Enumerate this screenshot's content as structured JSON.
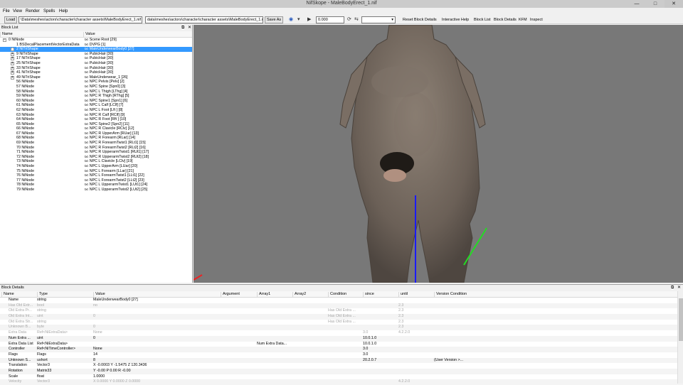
{
  "window": {
    "title": "NifSkope - MaleBodyErect_1.nif",
    "min": "—",
    "max": "□",
    "close": "✕"
  },
  "menu": [
    "File",
    "View",
    "Render",
    "Spells",
    "Help"
  ],
  "toolbar": {
    "load_label": "Load",
    "load_path": "\\Data\\meshes\\actors\\character\\character assets\\MaleBodyErect_1.nif",
    "save_path": "data\\meshes\\actors\\character\\character assets\\MaleBodyErect_1.nif",
    "save_as_label": "Save As",
    "time_value": "0.000",
    "reset_block_details": "Reset Block Details",
    "interactive_help": "Interactive Help",
    "block_list": "Block List",
    "block_details": "Block Details",
    "kfm": "KFM",
    "inspect": "Inspect"
  },
  "blocklist": {
    "title": "Block List",
    "col_name": "Name",
    "col_value": "Value",
    "rows": [
      {
        "name": "0 NiNode",
        "value": "Scene Root [29]",
        "depth": 0,
        "expand": "-"
      },
      {
        "name": "1 BSDecalPlacementVectorExtraData",
        "value": "DVPG [1]",
        "depth": 1
      },
      {
        "name": "2 NiTriShape",
        "value": "MaleUnderwearBody0 [27]",
        "depth": 1,
        "expand": "+",
        "selected": true
      },
      {
        "name": "9 NiTriShape",
        "value": "PubicHair [30]",
        "depth": 1,
        "expand": "+"
      },
      {
        "name": "17 NiTriShape",
        "value": "PubicHair [30]",
        "depth": 1,
        "expand": "+"
      },
      {
        "name": "25 NiTriShape",
        "value": "PubicHair [30]",
        "depth": 1,
        "expand": "+"
      },
      {
        "name": "33 NiTriShape",
        "value": "PubicHair [30]",
        "depth": 1,
        "expand": "+"
      },
      {
        "name": "41 NiTriShape",
        "value": "PubicHair [30]",
        "depth": 1,
        "expand": "+"
      },
      {
        "name": "49 NiTriShape",
        "value": "MaleUnderwear_1 [26]",
        "depth": 1,
        "expand": "+"
      },
      {
        "name": "56 NiNode",
        "value": "NPC Pelvis [Pelv] [2]",
        "depth": 1
      },
      {
        "name": "57 NiNode",
        "value": "NPC Spine [Spn0] [3]",
        "depth": 1
      },
      {
        "name": "58 NiNode",
        "value": "NPC L Thigh [LThg] [4]",
        "depth": 1
      },
      {
        "name": "59 NiNode",
        "value": "NPC R Thigh [RThg] [5]",
        "depth": 1
      },
      {
        "name": "60 NiNode",
        "value": "NPC Spine1 [Spn1] [6]",
        "depth": 1
      },
      {
        "name": "61 NiNode",
        "value": "NPC L Calf [LClf] [7]",
        "depth": 1
      },
      {
        "name": "62 NiNode",
        "value": "NPC L Foot [Lft ] [8]",
        "depth": 1
      },
      {
        "name": "63 NiNode",
        "value": "NPC R Calf [RClf] [9]",
        "depth": 1
      },
      {
        "name": "64 NiNode",
        "value": "NPC R Foot [Rft ] [10]",
        "depth": 1
      },
      {
        "name": "65 NiNode",
        "value": "NPC Spine2 [Spn2] [11]",
        "depth": 1
      },
      {
        "name": "66 NiNode",
        "value": "NPC R Clavicle [RClv] [12]",
        "depth": 1
      },
      {
        "name": "67 NiNode",
        "value": "NPC R UpperArm [RUar] [13]",
        "depth": 1
      },
      {
        "name": "68 NiNode",
        "value": "NPC R Forearm [RLar] [14]",
        "depth": 1
      },
      {
        "name": "69 NiNode",
        "value": "NPC R ForearmTwist1 [RLt1] [15]",
        "depth": 1
      },
      {
        "name": "70 NiNode",
        "value": "NPC R ForearmTwist2 [RLt2] [16]",
        "depth": 1
      },
      {
        "name": "71 NiNode",
        "value": "NPC R UpperarmTwist1 [RUt1] [17]",
        "depth": 1
      },
      {
        "name": "72 NiNode",
        "value": "NPC R UpperarmTwist2 [RUt2] [18]",
        "depth": 1
      },
      {
        "name": "73 NiNode",
        "value": "NPC L Clavicle [LClv] [19]",
        "depth": 1
      },
      {
        "name": "74 NiNode",
        "value": "NPC L UpperArm [LUar] [20]",
        "depth": 1
      },
      {
        "name": "75 NiNode",
        "value": "NPC L Forearm [LLar] [21]",
        "depth": 1
      },
      {
        "name": "76 NiNode",
        "value": "NPC L ForearmTwist1 [LLt1] [22]",
        "depth": 1
      },
      {
        "name": "77 NiNode",
        "value": "NPC L ForearmTwist2 [LLt2] [23]",
        "depth": 1
      },
      {
        "name": "78 NiNode",
        "value": "NPC L UpperarmTwist1 [LUt1] [24]",
        "depth": 1
      },
      {
        "name": "79 NiNode",
        "value": "NPC L UpperarmTwist2 [LUt2] [25]",
        "depth": 1
      }
    ]
  },
  "details": {
    "title": "Block Details",
    "columns": [
      "Name",
      "Type",
      "Value",
      "Argument",
      "Array1",
      "Array2",
      "Condition",
      "since",
      "until",
      "Version Condition"
    ],
    "rows": [
      {
        "cells": [
          "Name",
          "string",
          "MaleUnderwearBody0 [27]",
          "",
          "",
          "",
          "",
          "",
          "",
          ""
        ]
      },
      {
        "cells": [
          "Has Old Extr...",
          "bool",
          "no",
          "",
          "",
          "",
          "",
          "",
          "2.3",
          ""
        ],
        "disabled": true
      },
      {
        "cells": [
          "Old Extra Pr...",
          "string",
          "",
          "",
          "",
          "",
          "Has Old Extra ...",
          "",
          "2.3",
          ""
        ],
        "disabled": true
      },
      {
        "cells": [
          "Old Extra Int...",
          "uint",
          "0",
          "",
          "",
          "",
          "Has Old Extra ...",
          "",
          "2.3",
          ""
        ],
        "disabled": true
      },
      {
        "cells": [
          "Old Extra Str...",
          "string",
          "",
          "",
          "",
          "",
          "Has Old Extra ...",
          "",
          "2.3",
          ""
        ],
        "disabled": true
      },
      {
        "cells": [
          "Unknown B...",
          "byte",
          "0",
          "",
          "",
          "",
          "",
          "",
          "2.3",
          ""
        ],
        "disabled": true
      },
      {
        "cells": [
          "Extra Data",
          "Ref<NiExtraData>",
          "None",
          "",
          "",
          "",
          "",
          "3.0",
          "4.2.2.0",
          ""
        ],
        "disabled": true
      },
      {
        "cells": [
          "Num Extra ...",
          "uint",
          "0",
          "",
          "",
          "",
          "",
          "10.0.1.0",
          "",
          ""
        ]
      },
      {
        "cells": [
          "Extra Data List",
          "Ref<NiExtraData>",
          "",
          "",
          "Num Extra Data...",
          "",
          "",
          "10.0.1.0",
          "",
          ""
        ]
      },
      {
        "cells": [
          "Controller",
          "Ref<NiTimeController>",
          "None",
          "",
          "",
          "",
          "",
          "3.0",
          "",
          ""
        ]
      },
      {
        "cells": [
          "Flags",
          "Flags",
          "14",
          "",
          "",
          "",
          "",
          "3.0",
          "",
          ""
        ]
      },
      {
        "cells": [
          "Unknown S...",
          "ushort",
          "8",
          "",
          "",
          "",
          "",
          "20.2.0.7",
          "",
          "(User Version >..."
        ]
      },
      {
        "cells": [
          "Translation",
          "Vector3",
          "X -0.0003 Y -1.5475 Z 120.3436",
          "",
          "",
          "",
          "",
          "",
          "",
          ""
        ]
      },
      {
        "cells": [
          "Rotation",
          "Matrix33",
          "Y -0.00 P 0.00 R -0.00",
          "",
          "",
          "",
          "",
          "",
          "",
          ""
        ]
      },
      {
        "cells": [
          "Scale",
          "float",
          "1.0000",
          "",
          "",
          "",
          "",
          "",
          "",
          ""
        ]
      },
      {
        "cells": [
          "Velocity",
          "Vector3",
          "X 0.0000 Y 0.0000 Z 0.0000",
          "",
          "",
          "",
          "",
          "",
          "4.2.2.0",
          ""
        ],
        "disabled": true
      }
    ]
  },
  "colors": {
    "viewport_bg": "#787878",
    "selection": "#3399ff",
    "axis_blue": "#1a1aff",
    "axis_green": "#22dd22",
    "axis_red": "#ee2222"
  }
}
